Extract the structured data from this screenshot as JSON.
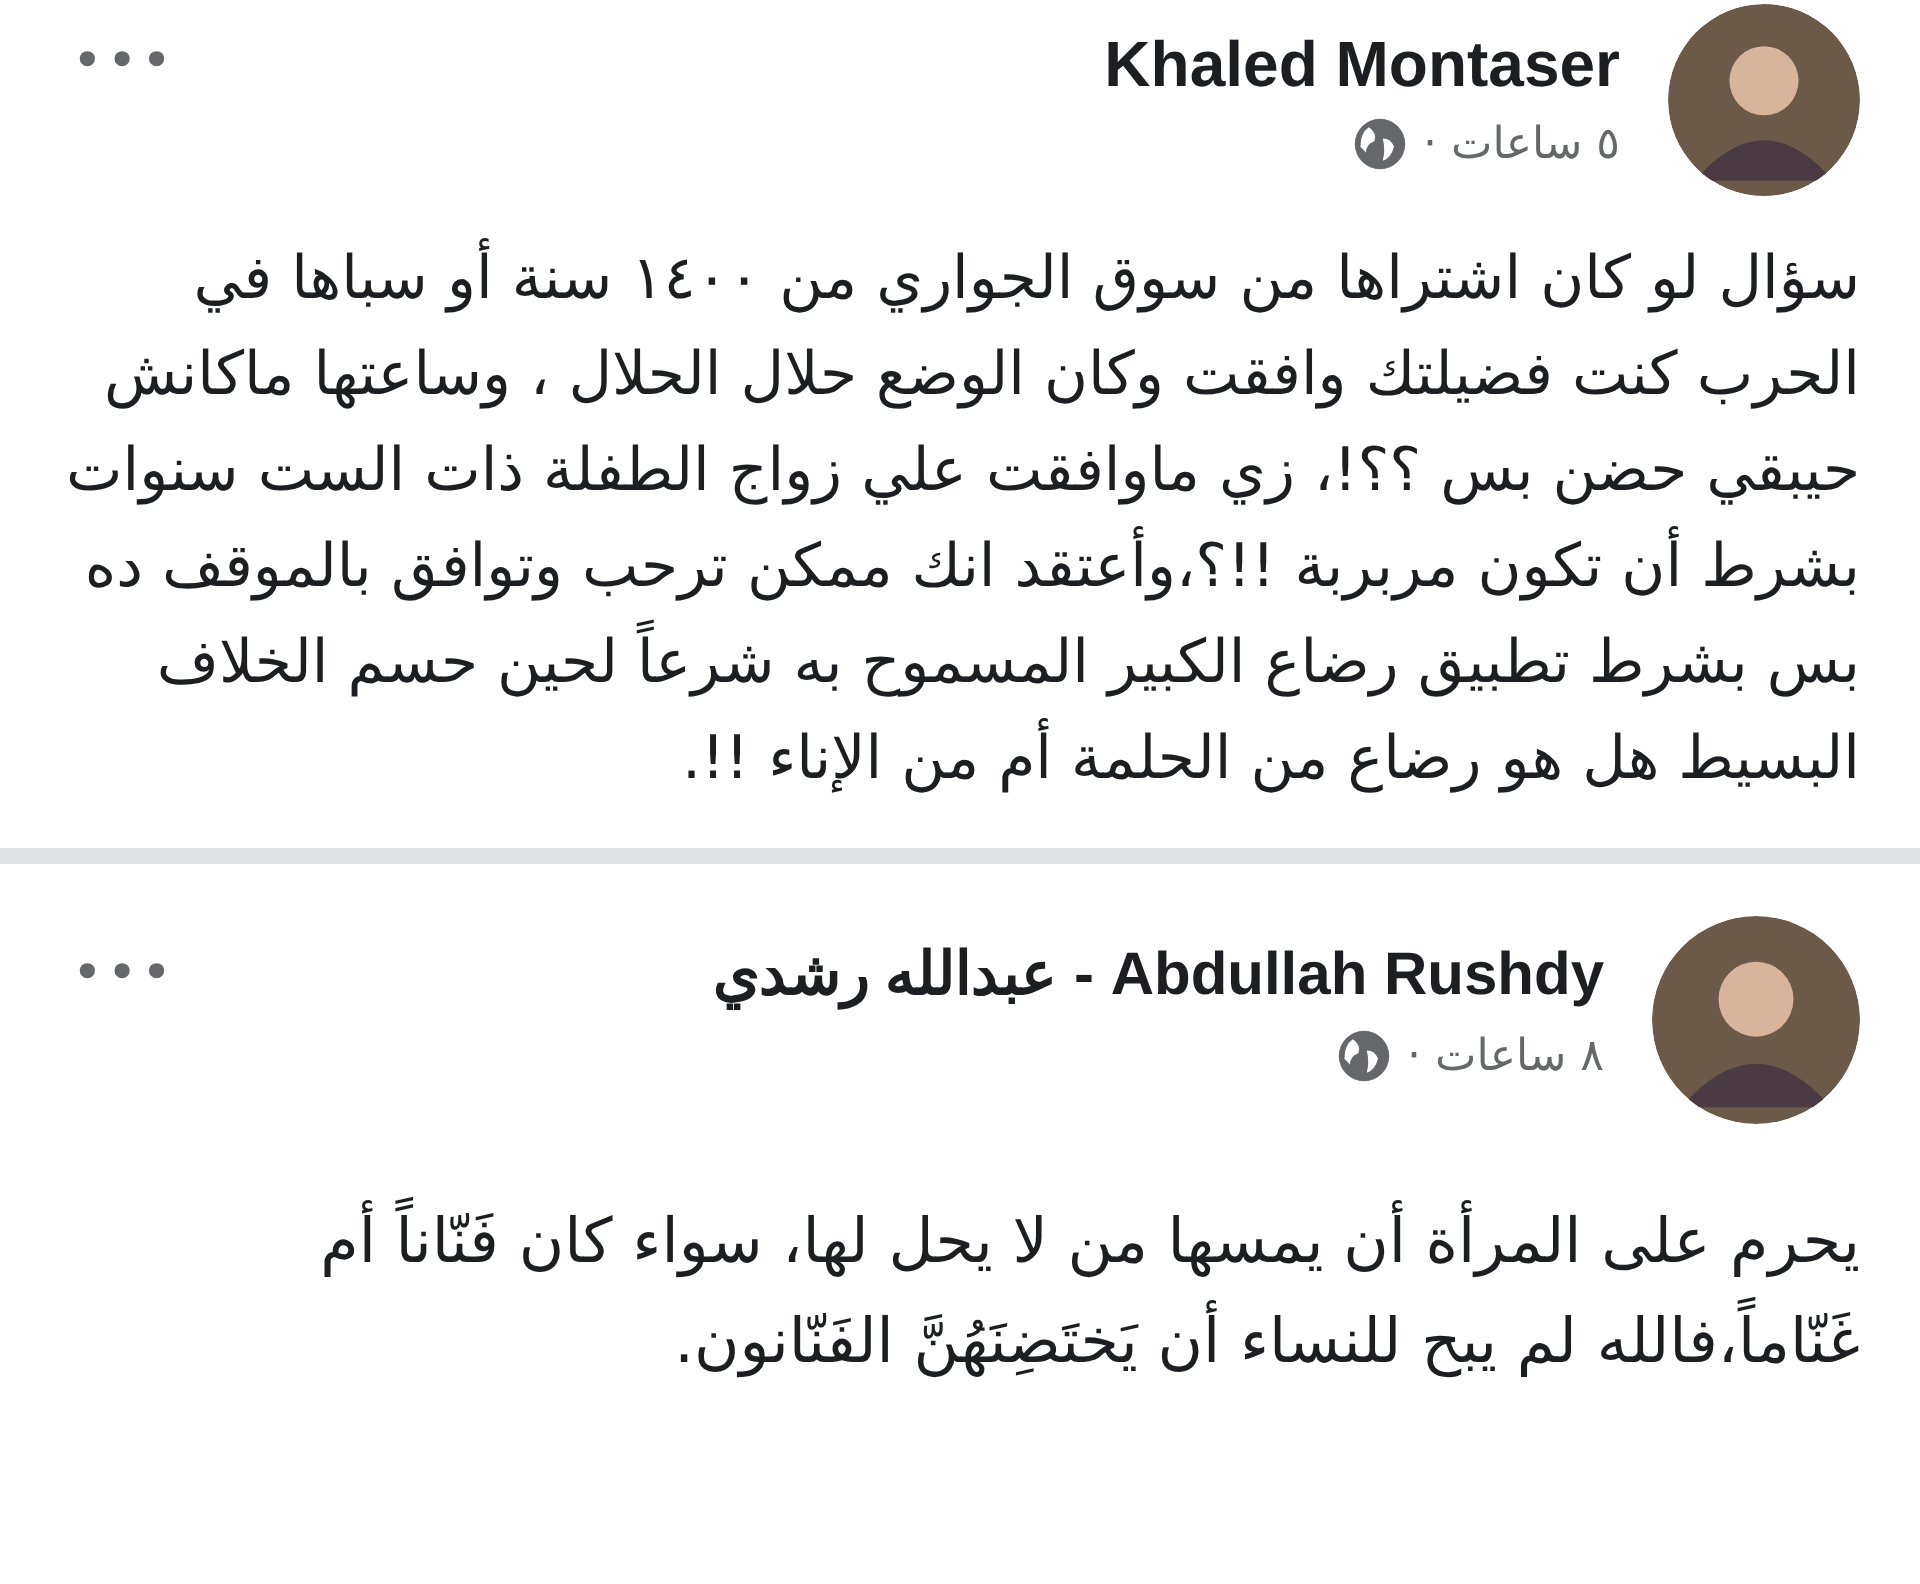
{
  "posts": [
    {
      "author": "Khaled Montaser",
      "time": "٥ ساعات ·",
      "text": "سؤال لو كان اشتراها من سوق الجواري من ١٤٠٠ سنة أو سباها في الحرب كنت فضيلتك وافقت وكان الوضع حلال الحلال ، وساعتها ماكانش حيبقي حضن بس ؟؟!، زي ماوافقت علي زواج الطفلة ذات الست سنوات بشرط أن تكون مربربة !!؟،وأعتقد انك ممكن ترحب وتوافق بالموقف ده بس بشرط تطبيق رضاع الكبير المسموح به شرعاً لحين حسم الخلاف البسيط هل هو رضاع من الحلمة أم من الإناء  !!.",
      "more": "•••"
    },
    {
      "author": "عبدالله رشدي - Abdullah Rushdy",
      "time": "٨ ساعات ·",
      "text": "يحرم على المرأة أن يمسها من لا يحل لها، سواء كان فَنّاناً أم غَنّاماً،فالله لم يبح للنساء أن يَختَضِنَهُنَّ الفَنّانون.",
      "more": "•••"
    }
  ]
}
